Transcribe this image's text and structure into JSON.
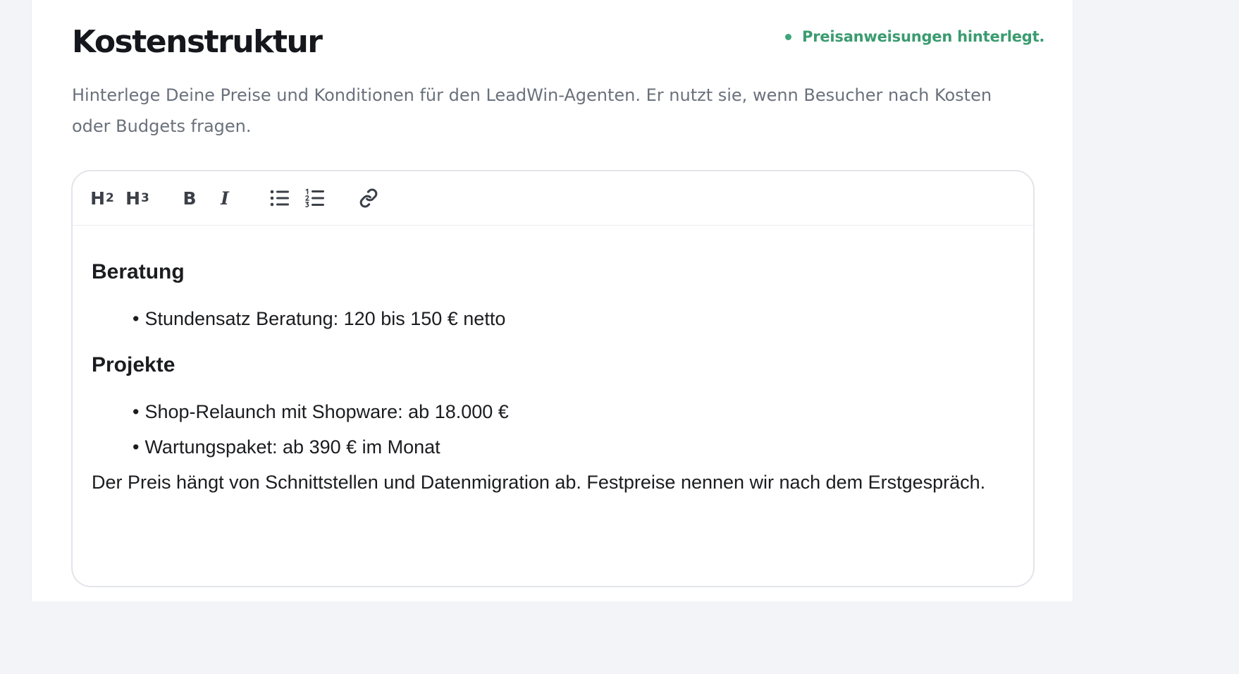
{
  "header": {
    "title": "Kostenstruktur",
    "status_text": "Preisanweisungen hinterlegt.",
    "description": "Hinterlege Deine Preise und Konditionen für den LeadWin-Agenten. Er nutzt sie, wenn Besucher nach Kosten oder Budgets fragen."
  },
  "toolbar": {
    "h2_label": "H",
    "h2_level": "2",
    "h3_label": "H",
    "h3_level": "3",
    "bold_label": "B",
    "italic_label": "I"
  },
  "content": {
    "section1_heading": "Beratung",
    "section1_items": [
      "Stundensatz Beratung: 120 bis 150 € netto"
    ],
    "section2_heading": "Projekte",
    "section2_items": [
      "Shop-Relaunch mit Shopware: ab 18.000 €",
      "Wartungspaket: ab 390 € im Monat"
    ],
    "paragraph": "Der Preis hängt von Schnittstellen und Datenmigration ab. Festpreise nennen wir nach dem Erstgespräch."
  },
  "colors": {
    "status_green": "#3a9b6f",
    "text_dark": "#15171c",
    "text_muted": "#6a717c",
    "border": "#e3e5ea"
  },
  "icons": [
    "bullet-list-icon",
    "numbered-list-icon",
    "link-icon"
  ]
}
